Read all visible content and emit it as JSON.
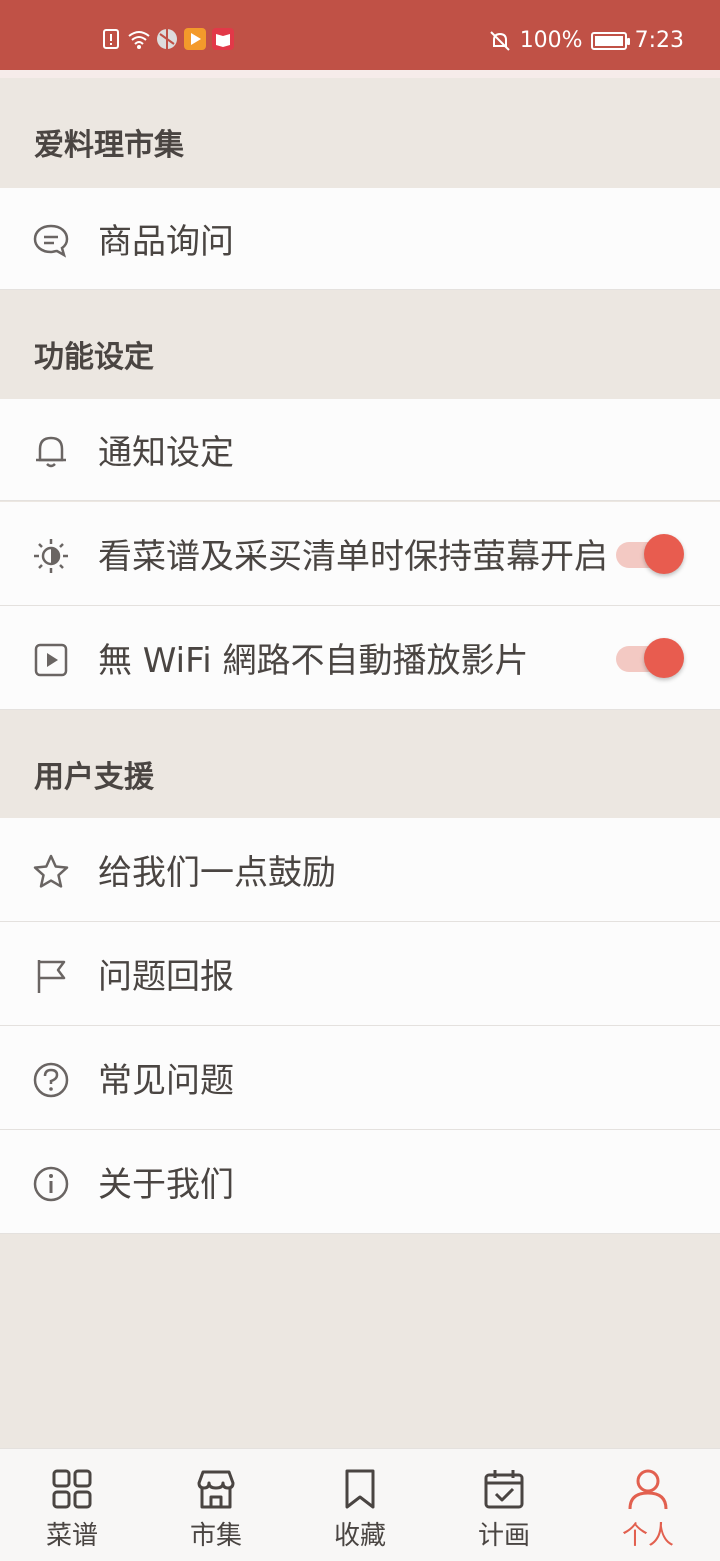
{
  "status_bar": {
    "battery": "100%",
    "time": "7:23",
    "notification_icons": [
      "alert-icon",
      "wifi-icon",
      "app-icon",
      "video-app-icon",
      "book-app-icon"
    ]
  },
  "sections": [
    {
      "title": "爱料理市集",
      "items": [
        {
          "label": "商品询问",
          "icon": "chat-icon"
        }
      ]
    },
    {
      "title": "功能设定",
      "items": [
        {
          "label": "通知设定",
          "icon": "bell-icon"
        },
        {
          "label": "看菜谱及采买清单时保持萤幕开启",
          "icon": "brightness-icon",
          "toggle": true
        },
        {
          "label": "無 WiFi 網路不自動播放影片",
          "icon": "video-icon",
          "toggle": true
        }
      ]
    },
    {
      "title": "用户支援",
      "items": [
        {
          "label": "给我们一点鼓励",
          "icon": "star-icon"
        },
        {
          "label": "问题回报",
          "icon": "flag-icon"
        },
        {
          "label": "常见问题",
          "icon": "question-icon"
        },
        {
          "label": "关于我们",
          "icon": "info-icon"
        }
      ]
    }
  ],
  "bottom_nav": [
    {
      "label": "菜谱",
      "icon": "grid-icon"
    },
    {
      "label": "市集",
      "icon": "store-icon"
    },
    {
      "label": "收藏",
      "icon": "bookmark-icon"
    },
    {
      "label": "计画",
      "icon": "calendar-check-icon"
    },
    {
      "label": "个人",
      "icon": "person-icon",
      "active": true
    }
  ],
  "colors": {
    "status_bar": "#C05146",
    "accent": "#E85C4F",
    "background": "#ECE7E1",
    "row_background": "#FCFCFC",
    "text": "#4A4542"
  }
}
